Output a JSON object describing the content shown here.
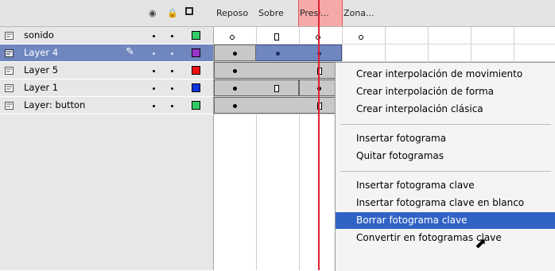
{
  "header": {
    "visibility_icon": "eye-icon",
    "lock_icon": "lock-icon",
    "outline_icon": "square-outline-icon",
    "frame_labels": [
      "Reposo",
      "Sobre",
      "Presi...",
      "Zona..."
    ]
  },
  "layers": [
    {
      "name": "sonido",
      "color": "#33cc66"
    },
    {
      "name": "Layer 4",
      "color": "#9933cc",
      "selected": true
    },
    {
      "name": "Layer 5",
      "color": "#ee1111"
    },
    {
      "name": "Layer 1",
      "color": "#1133dd"
    },
    {
      "name": "Layer: button",
      "color": "#33cc66"
    }
  ],
  "context_menu": {
    "items": [
      "Crear interpolación de movimiento",
      "Crear interpolación de forma",
      "Crear interpolación clásica",
      "Insertar fotograma",
      "Quitar fotogramas",
      "Insertar fotograma clave",
      "Insertar fotograma clave en blanco",
      "Borrar fotograma clave",
      "Convertir en fotogramas clave"
    ],
    "highlighted": "Borrar fotograma clave"
  }
}
